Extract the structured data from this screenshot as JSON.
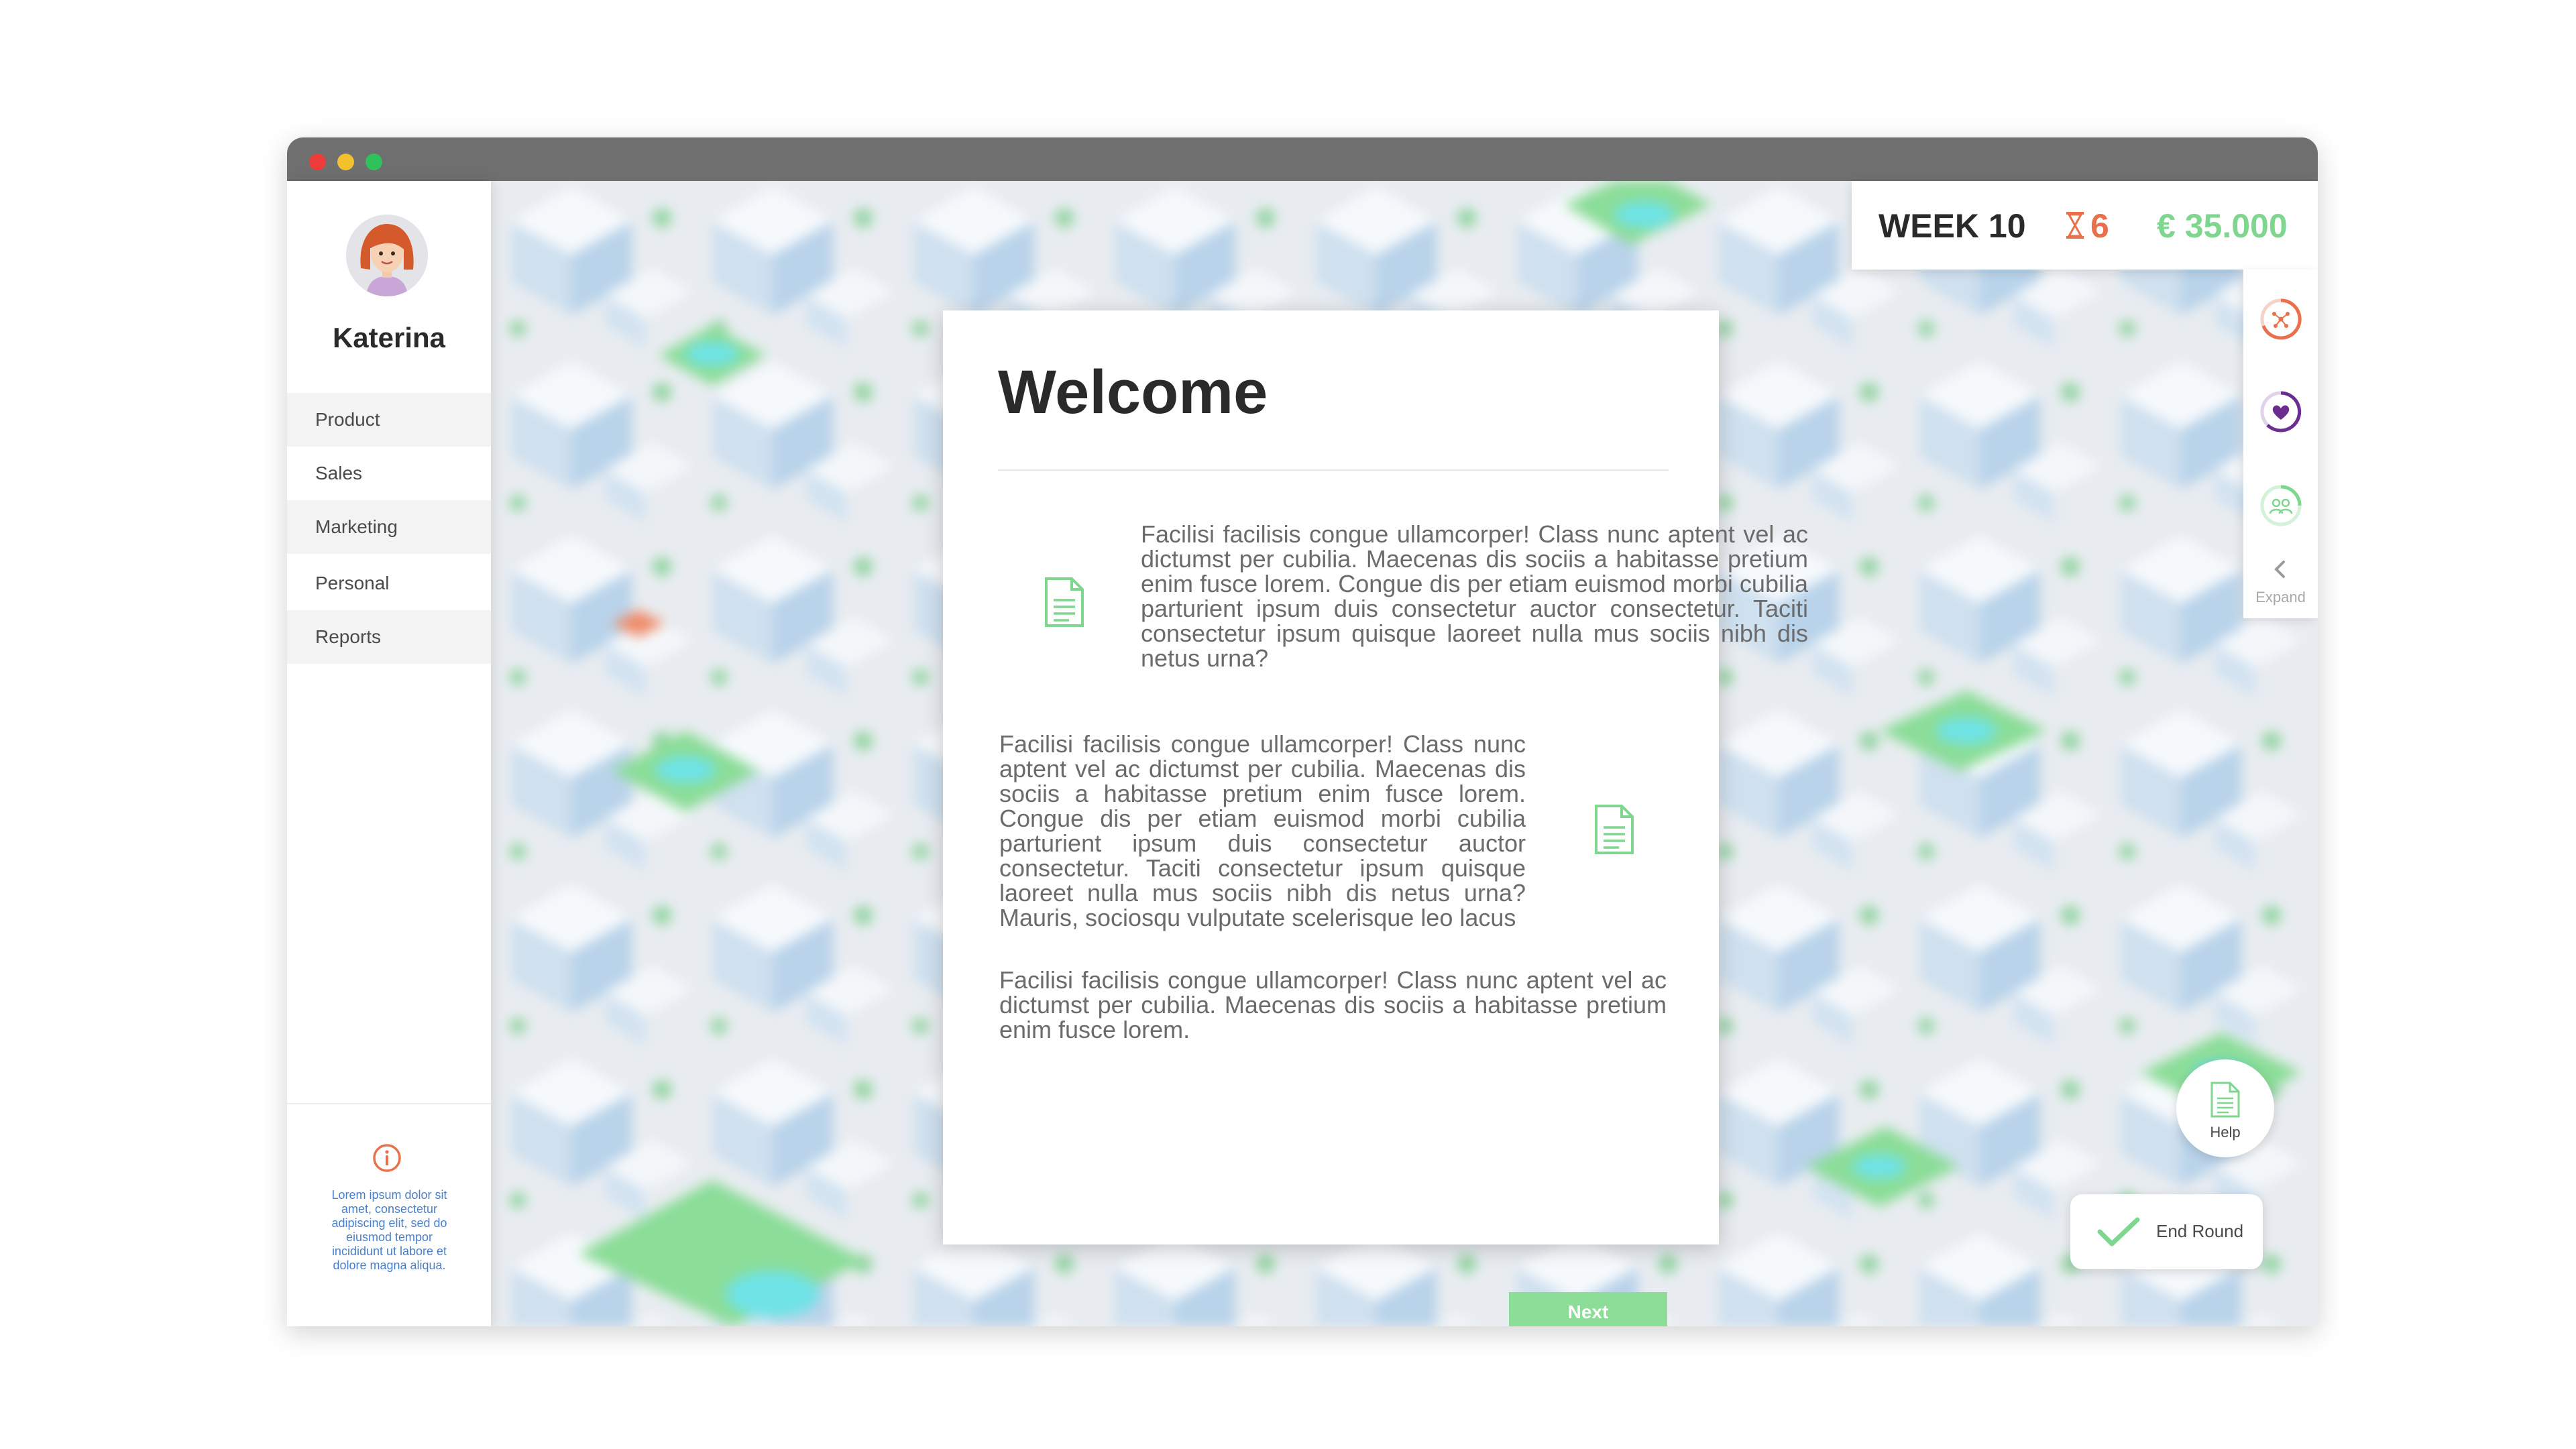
{
  "user": {
    "name": "Katerina"
  },
  "sidebar": {
    "items": [
      {
        "label": "Product"
      },
      {
        "label": "Sales"
      },
      {
        "label": "Marketing"
      },
      {
        "label": "Personal"
      },
      {
        "label": "Reports"
      }
    ],
    "info_text": "Lorem ipsum dolor sit amet, consectetur adipiscing elit, sed do eiusmod tempor incididunt ut labore et dolore magna aliqua."
  },
  "status": {
    "week": "WEEK 10",
    "turns": "6",
    "money": "€ 35.000"
  },
  "rail": {
    "expand_label": "Expand",
    "icons": [
      "network-icon",
      "heart-icon",
      "people-icon"
    ]
  },
  "modal": {
    "title": "Welcome",
    "paragraphs": [
      "Facilisi facilisis congue ullamcorper! Class nunc aptent vel ac dictumst per cubilia. Maecenas dis sociis a habitasse pretium enim fusce lorem. Congue dis per etiam euismod morbi cubilia parturient ipsum duis consectetur auctor consectetur. Taciti consectetur ipsum quisque laoreet nulla mus sociis nibh dis netus urna?",
      "Facilisi facilisis congue ullamcorper! Class nunc aptent vel ac dictumst per cubilia. Maecenas dis sociis a habitasse pretium enim fusce lorem. Congue dis per etiam euismod morbi cubilia parturient ipsum duis consectetur auctor consectetur. Taciti consectetur ipsum quisque laoreet nulla mus sociis nibh dis netus urna? Mauris, sociosqu vulputate scelerisque leo lacus",
      "Facilisi facilisis congue ullamcorper! Class nunc aptent vel ac dictumst per cubilia. Maecenas dis sociis a habitasse pretium enim fusce lorem."
    ],
    "next_label": "Next"
  },
  "help": {
    "label": "Help"
  },
  "end_round": {
    "label": "End Round"
  },
  "colors": {
    "accent_green": "#7fd68f",
    "accent_orange": "#e8704a",
    "accent_purple": "#6b2d8f",
    "link_blue": "#4a7fc9"
  }
}
